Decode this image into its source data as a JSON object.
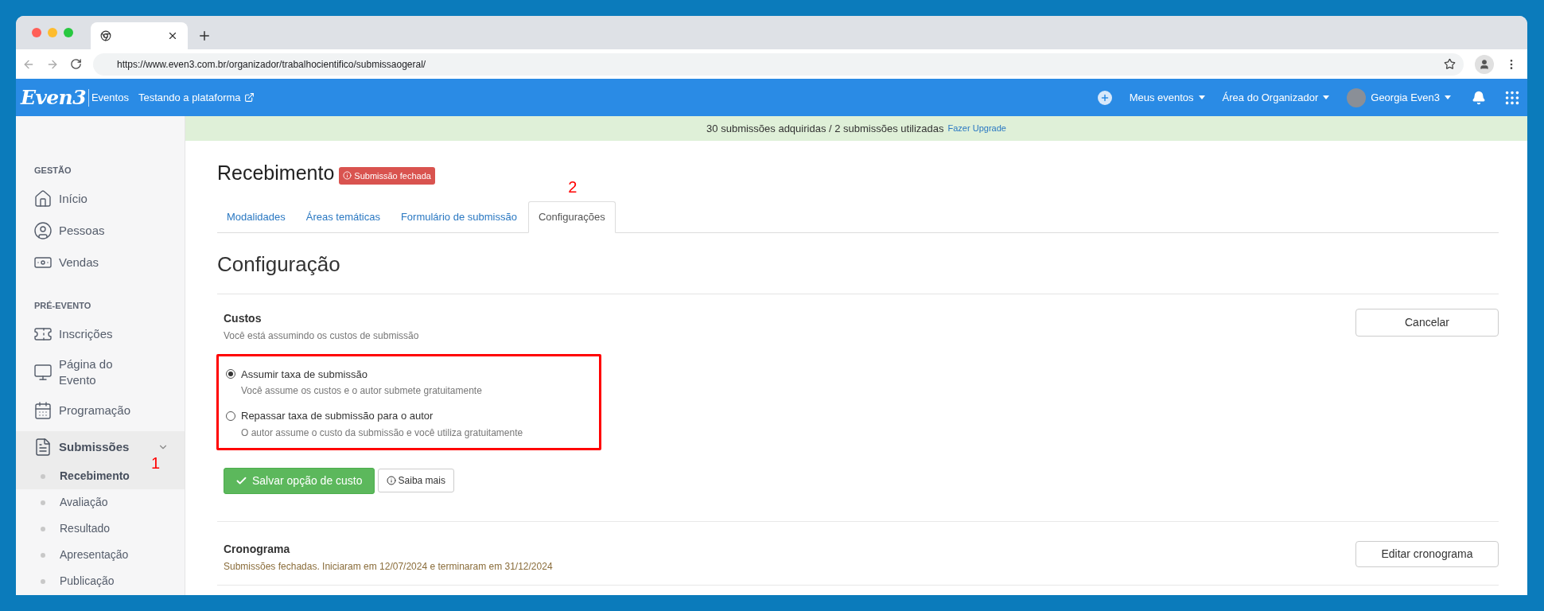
{
  "browser": {
    "url": "https://www.even3.com.br/organizador/trabalhocientifico/submissaogeral/"
  },
  "app_nav": {
    "logo": "Even3",
    "section": "Eventos",
    "event_link": "Testando a plataforma",
    "menus": [
      {
        "label": "Meus eventos"
      },
      {
        "label": "Área do Organizador"
      }
    ],
    "user": "Georgia Even3"
  },
  "banner": {
    "text": "30 submissões adquiridas / 2 submissões utilizadas",
    "link": "Fazer Upgrade"
  },
  "sidebar": {
    "annotation": "1",
    "sections": [
      {
        "heading": "GESTÃO",
        "items": [
          {
            "label": "Início",
            "selected": false
          },
          {
            "label": "Pessoas",
            "selected": false
          },
          {
            "label": "Vendas",
            "selected": false
          }
        ]
      },
      {
        "heading": "PRÉ-EVENTO",
        "items": [
          {
            "label": "Inscrições",
            "selected": false
          },
          {
            "label": "Página do Evento",
            "selected": false
          },
          {
            "label": "Programação",
            "selected": false
          },
          {
            "label": "Submissões",
            "selected": true,
            "expanded": true,
            "children": [
              {
                "label": "Recebimento",
                "selected": true
              },
              {
                "label": "Avaliação",
                "selected": false
              },
              {
                "label": "Resultado",
                "selected": false
              },
              {
                "label": "Apresentação",
                "selected": false
              },
              {
                "label": "Publicação",
                "selected": false
              }
            ]
          }
        ]
      }
    ]
  },
  "page": {
    "title": "Recebimento",
    "status_badge": "Submissão fechada",
    "tabs_annotation": "2",
    "tabs": [
      {
        "label": "Modalidades",
        "selected": false
      },
      {
        "label": "Áreas temáticas",
        "selected": false
      },
      {
        "label": "Formulário de submissão",
        "selected": false
      },
      {
        "label": "Configurações",
        "selected": true
      }
    ],
    "section_title": "Configuração",
    "costs": {
      "title": "Custos",
      "subtitle": "Você está assumindo os custos de submissão",
      "cancel_button": "Cancelar",
      "options": [
        {
          "label": "Assumir taxa de submissão",
          "description": "Você assume os custos e o autor submete gratuitamente",
          "selected": true
        },
        {
          "label": "Repassar taxa de submissão para o autor",
          "description": "O autor assume o custo da submissão e você utiliza gratuitamente",
          "selected": false
        }
      ],
      "save_button": "Salvar opção de custo",
      "info_button": "Saiba mais"
    },
    "schedule": {
      "title": "Cronograma",
      "text": "Submissões fechadas. Iniciaram em 12/07/2024 e terminaram em 31/12/2024",
      "button": "Editar cronograma"
    }
  }
}
